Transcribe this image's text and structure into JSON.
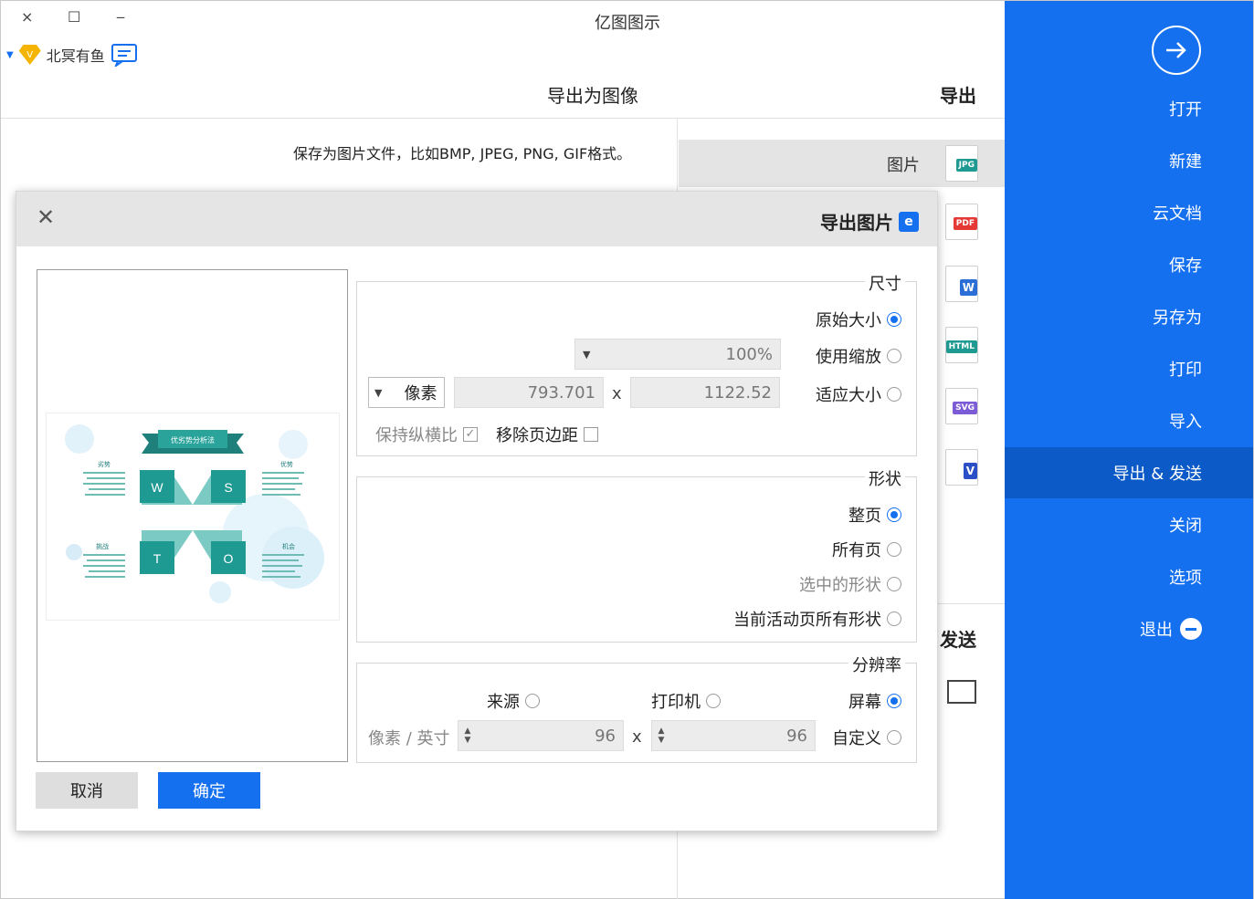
{
  "app": {
    "title": "亿图图示",
    "user": "北冥有鱼"
  },
  "window_buttons": {
    "close": "×",
    "maximize": "☐",
    "minimize": "‒"
  },
  "page": {
    "export_header": "导出",
    "section_title": "导出为图像",
    "description": "保存为图片文件，比如BMP, JPEG, PNG, GIF格式。",
    "selected_format_label": "图片",
    "send_header": "发送"
  },
  "sidebar": {
    "items": [
      "打开",
      "新建",
      "云文档",
      "保存",
      "另存为",
      "打印",
      "导入",
      "导出 & 发送",
      "关闭",
      "选项",
      "退出"
    ],
    "active": "导出 & 发送"
  },
  "formats": [
    "JPG",
    "PDF",
    "W",
    "HTML",
    "SVG",
    "V"
  ],
  "dialog": {
    "title": "导出图片",
    "size": {
      "title": "尺寸",
      "original": "原始大小",
      "zoom": "使用缩放",
      "zoom_value": "100%",
      "fit": "适应大小",
      "width": "1122.52",
      "height": "793.701",
      "unit": "像素",
      "x": "x",
      "remove_margin": "移除页边距",
      "keep_ratio": "保持纵横比",
      "keep_ratio_check": "✓"
    },
    "shape": {
      "title": "形状",
      "whole_page": "整页",
      "all_pages": "所有页",
      "selected_shapes": "选中的形状",
      "current_page_shapes": "当前活动页所有形状"
    },
    "resolution": {
      "title": "分辨率",
      "screen": "屏幕",
      "printer": "打印机",
      "source": "来源",
      "custom": "自定义",
      "dpi_x": "96",
      "dpi_y": "96",
      "unit": "像素 / 英寸",
      "x": "x"
    },
    "ok": "确定",
    "cancel": "取消",
    "preview": {
      "banner": "优劣势分析法",
      "letters": [
        "S",
        "W",
        "O",
        "T"
      ],
      "labels": [
        "优势",
        "劣势",
        "机会",
        "挑战"
      ]
    }
  },
  "colors": {
    "accent": "#1570f0",
    "teal": "#1f9a93"
  }
}
